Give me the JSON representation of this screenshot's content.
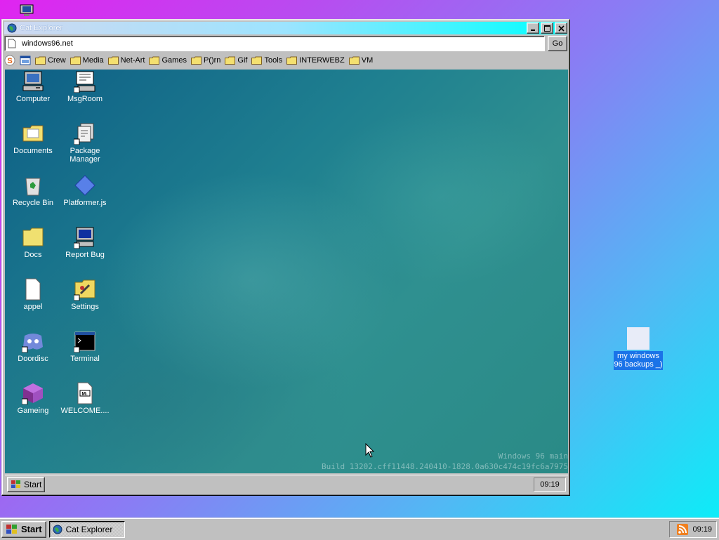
{
  "desktop": {
    "backup_folder_label": "my windows 96 backups _)"
  },
  "window": {
    "title": "Cat Explorer",
    "address": "windows96.net",
    "go_label": "Go",
    "links": [
      "Crew",
      "Media",
      "Net-Art",
      "Games",
      "P()rn",
      "Gif",
      "Tools",
      "INTERWEBZ",
      "VM"
    ]
  },
  "inner_desktop": {
    "icons": [
      {
        "label": "Computer",
        "icon": "computer-icon"
      },
      {
        "label": "MsgRoom",
        "icon": "msgroom-icon"
      },
      {
        "label": "Documents",
        "icon": "documents-folder-icon"
      },
      {
        "label": "Package Manager",
        "icon": "package-manager-icon"
      },
      {
        "label": "Recycle Bin",
        "icon": "recycle-bin-icon"
      },
      {
        "label": "Platformer.js",
        "icon": "platformer-icon"
      },
      {
        "label": "Docs",
        "icon": "folder-icon"
      },
      {
        "label": "Report Bug",
        "icon": "report-bug-icon"
      },
      {
        "label": "appel",
        "icon": "document-icon"
      },
      {
        "label": "Settings",
        "icon": "settings-icon"
      },
      {
        "label": "Doordisc",
        "icon": "discord-icon"
      },
      {
        "label": "Terminal",
        "icon": "terminal-icon"
      },
      {
        "label": "Gameing",
        "icon": "cube-icon"
      },
      {
        "label": "WELCOME....",
        "icon": "markdown-file-icon"
      }
    ],
    "build_line1": "Windows 96 main",
    "build_line2": "Build 13202.cff11448.240410-1828.0a630c474c19fc6a7975",
    "start_label": "Start",
    "clock": "09:19"
  },
  "taskbar": {
    "start_label": "Start",
    "task_label": "Cat Explorer",
    "clock": "09:19"
  }
}
